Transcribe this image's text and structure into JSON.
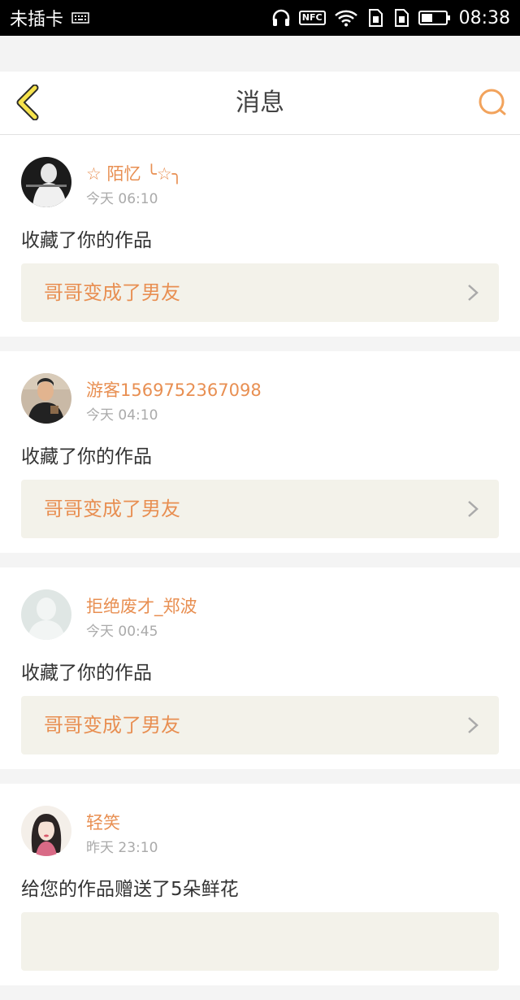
{
  "status_bar": {
    "carrier": "未插卡",
    "nfc": "NFC",
    "time": "08:38",
    "icons": [
      "sim-keyboard-icon",
      "headphones-icon",
      "nfc-icon",
      "wifi-icon",
      "sim-1-icon",
      "sim-2-icon",
      "battery-icon"
    ]
  },
  "header": {
    "title": "消息",
    "back_icon": "chevron-left-icon",
    "search_icon": "search-icon",
    "accent_color": "#f2a35c"
  },
  "colors": {
    "username": "#e88f52",
    "link_bg": "#f3f2ea",
    "back_arrow_fill": "#f6e34d"
  },
  "messages": [
    {
      "username": "☆ 陌忆 ╰☆╮",
      "time": "今天 06:10",
      "action": "收藏了你的作品",
      "work_title": "哥哥变成了男友",
      "avatar": "dark-portrait-avatar"
    },
    {
      "username": "游客1569752367098",
      "time": "今天 04:10",
      "action": "收藏了你的作品",
      "work_title": "哥哥变成了男友",
      "avatar": "boy-photo-avatar"
    },
    {
      "username": "拒绝废才_郑波",
      "time": "今天 00:45",
      "action": "收藏了你的作品",
      "work_title": "哥哥变成了男友",
      "avatar": "default-silhouette-avatar"
    },
    {
      "username": "轻笑",
      "time": "昨天 23:10",
      "action": "给您的作品赠送了5朵鲜花",
      "work_title": "",
      "avatar": "illustrated-girl-avatar"
    }
  ]
}
